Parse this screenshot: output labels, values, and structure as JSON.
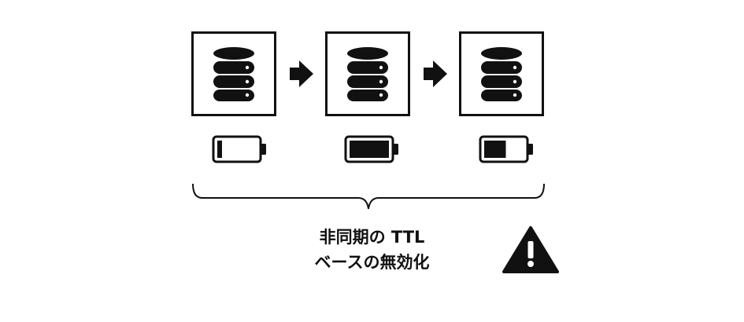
{
  "diagram": {
    "stages": [
      {
        "database_icon": "database-icon",
        "battery_icon": "battery-icon",
        "battery_level": 0.12
      },
      {
        "database_icon": "database-icon",
        "battery_icon": "battery-icon",
        "battery_level": 1.0
      },
      {
        "database_icon": "database-icon",
        "battery_icon": "battery-icon",
        "battery_level": 0.55
      }
    ],
    "arrow_icon": "arrow-right-icon",
    "brace_icon": "curly-brace-icon",
    "caption": {
      "line1": "非同期の TTL",
      "line2": "ベースの無効化"
    },
    "warning_icon": "warning-triangle-icon",
    "colors": {
      "ink": "#111111",
      "background": "#ffffff"
    }
  }
}
